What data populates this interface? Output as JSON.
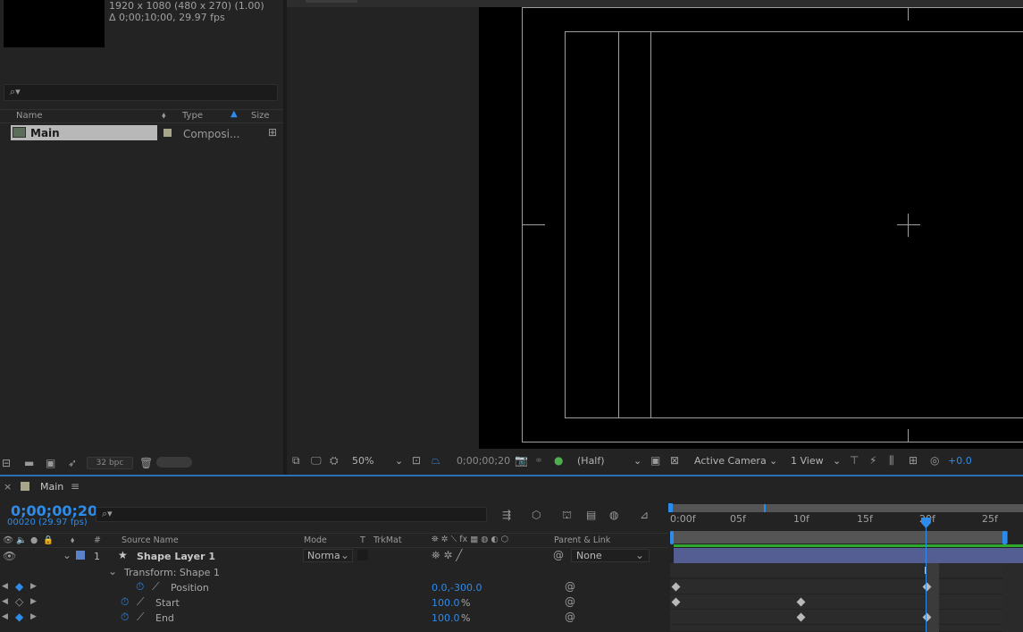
{
  "project": {
    "info_resolution": "1920 x 1080  (480 x 270) (1.00)",
    "info_duration": "Δ 0;00;10;00, 29.97 fps",
    "search_placeholder": "",
    "columns": {
      "name": "Name",
      "type": "Type",
      "size": "Size"
    },
    "items": [
      {
        "name": "Main",
        "type": "Composi..."
      }
    ],
    "bpc": "32 bpc"
  },
  "viewer": {
    "zoom": "50%",
    "timecode": "0;00;00;20",
    "resolution": "(Half)",
    "camera": "Active Camera",
    "views": "1 View",
    "exposure": "+0.0"
  },
  "timeline": {
    "tab_label": "Main",
    "current_time": "0;00;00;20",
    "frame_info": "00020 (29.97 fps)",
    "columns": {
      "num": "#",
      "source_name": "Source Name",
      "mode": "Mode",
      "t": "T",
      "trkmat": "TrkMat",
      "parent": "Parent & Link"
    },
    "ruler_ticks": [
      "0:00f",
      "05f",
      "10f",
      "15f",
      "20f",
      "25f"
    ],
    "layer": {
      "number": "1",
      "name": "Shape Layer 1",
      "mode": "Norma",
      "parent": "None"
    },
    "group": "Transform: Shape 1",
    "properties": [
      {
        "name": "Position",
        "value": "0.0,-300.0"
      },
      {
        "name": "Start",
        "value": "100.0",
        "unit": "%"
      },
      {
        "name": "End",
        "value": "100.0",
        "unit": "%"
      }
    ],
    "playhead_frame": 20,
    "total_frames": 30
  },
  "colors": {
    "accent": "#2d8ceb",
    "layer_label": "#5b82c9",
    "layer_bar": "#545e93",
    "work_area": "#2ea82e"
  }
}
